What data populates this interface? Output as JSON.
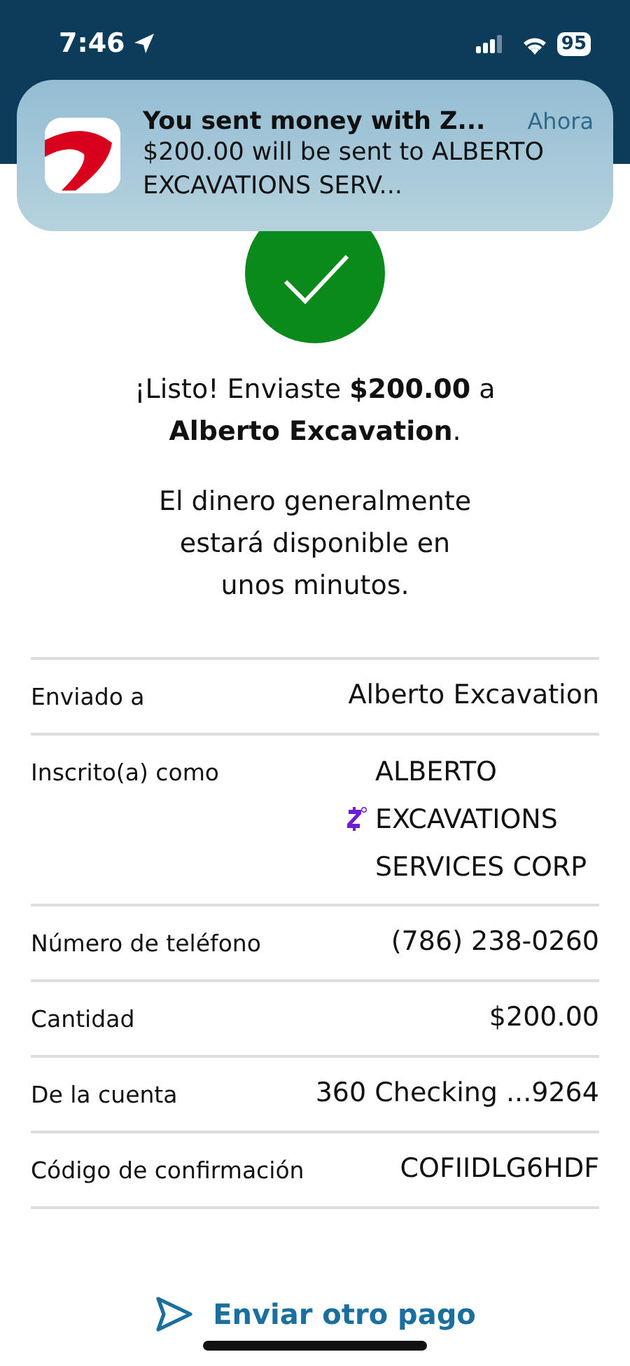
{
  "status_bar": {
    "time": "7:46",
    "battery": "95"
  },
  "notification": {
    "title": "You sent money with Z...",
    "time": "Ahora",
    "body": "$200.00 will be sent to ALBERTO EXCAVATIONS SERV..."
  },
  "confirmation": {
    "message": "¡Listo! Enviaste **$200.00** a **Alberto Excavation**.",
    "note": "El dinero generalmente estará disponible en unos minutos."
  },
  "details": [
    {
      "kind": "text",
      "label": "Enviado a",
      "value": "Alberto Excavation"
    },
    {
      "kind": "zelle",
      "label": "Inscrito(a) como",
      "value": "ALBERTO EXCAVATIONS SERVICES CORP"
    },
    {
      "kind": "text",
      "label": "Número de teléfono",
      "value": "(786) 238-0260"
    },
    {
      "kind": "text",
      "label": "Cantidad",
      "value": "$200.00"
    },
    {
      "kind": "text",
      "label": "De la cuenta",
      "value": "360 Checking ...9264"
    },
    {
      "kind": "text",
      "label": "Código de confirmación",
      "value": "COFIIDLG6HDF"
    }
  ],
  "action": {
    "label": "Enviar otro pago"
  }
}
